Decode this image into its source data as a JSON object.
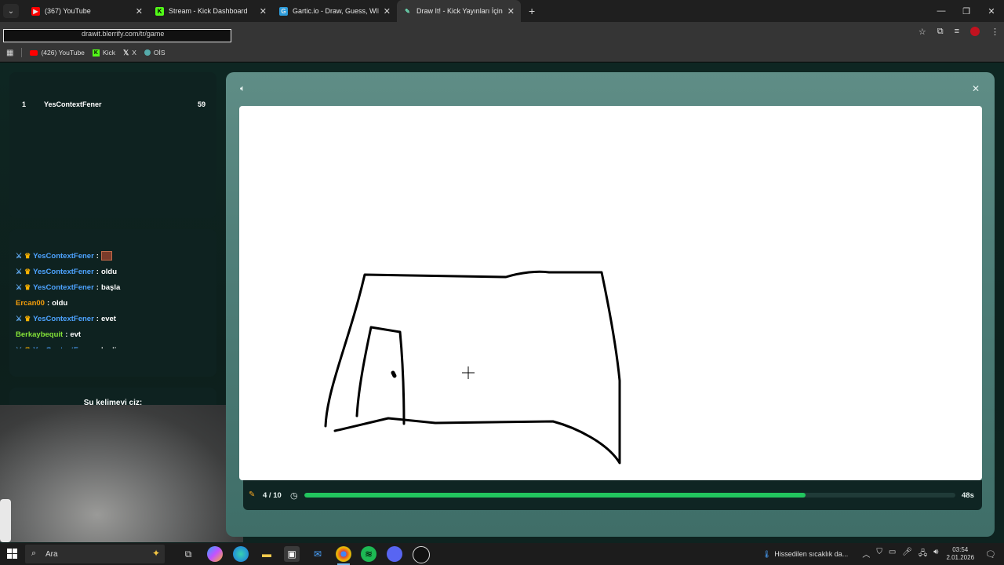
{
  "browser": {
    "tabs": [
      {
        "title": "(367) YouTube",
        "icon": "youtube-icon",
        "active": false
      },
      {
        "title": "Stream - Kick Dashboard",
        "icon": "kick-icon",
        "active": false
      },
      {
        "title": "Gartic.io - Draw, Guess, WIN",
        "icon": "gartic-icon",
        "active": false
      },
      {
        "title": "Draw It! - Kick Yayınları İçin Çizi",
        "icon": "drawit-icon",
        "active": true
      }
    ],
    "new_tab": "+",
    "close_glyph": "✕",
    "url": "drawit.blerrify.com/tr/game",
    "bookmarks": [
      {
        "label": "(426) YouTube",
        "icon": "youtube-icon"
      },
      {
        "label": "Kick",
        "icon": "kick-icon"
      },
      {
        "label": "X",
        "icon": "x-icon"
      },
      {
        "label": "OİS",
        "icon": "ois-icon"
      }
    ]
  },
  "scoreboard": {
    "rows": [
      {
        "rank": "1",
        "name": "YesContextFener",
        "score": "59"
      }
    ]
  },
  "chat": {
    "messages": [
      {
        "badges": true,
        "user": "YesContextFener",
        "user_color": "#4da3ff",
        "text": "",
        "emote": true
      },
      {
        "badges": true,
        "user": "YesContextFener",
        "user_color": "#4da3ff",
        "text": "oldu",
        "emote": false
      },
      {
        "badges": true,
        "user": "YesContextFener",
        "user_color": "#4da3ff",
        "text": "başla",
        "emote": false
      },
      {
        "badges": false,
        "user": "Ercan00",
        "user_color": "#f59e0b",
        "text": "oldu",
        "emote": false
      },
      {
        "badges": true,
        "user": "YesContextFener",
        "user_color": "#4da3ff",
        "text": "evet",
        "emote": false
      },
      {
        "badges": false,
        "user": "Berkaybequit",
        "user_color": "#84e338",
        "text": "evt",
        "emote": false
      },
      {
        "badges": true,
        "user": "YesContextFener",
        "user_color": "#4da3ff",
        "text": "hadi",
        "emote": false
      }
    ]
  },
  "word_card": {
    "prompt": "Şu kelimeyi çiz:"
  },
  "game": {
    "round": "4 / 10",
    "time_left": "48s",
    "progress_fraction": 0.77,
    "accent": "#22c55e"
  },
  "taskbar": {
    "search_placeholder": "Ara",
    "weather": "Hissedilen sıcaklık da...",
    "time": "03:54",
    "date": "2.01.2026"
  }
}
